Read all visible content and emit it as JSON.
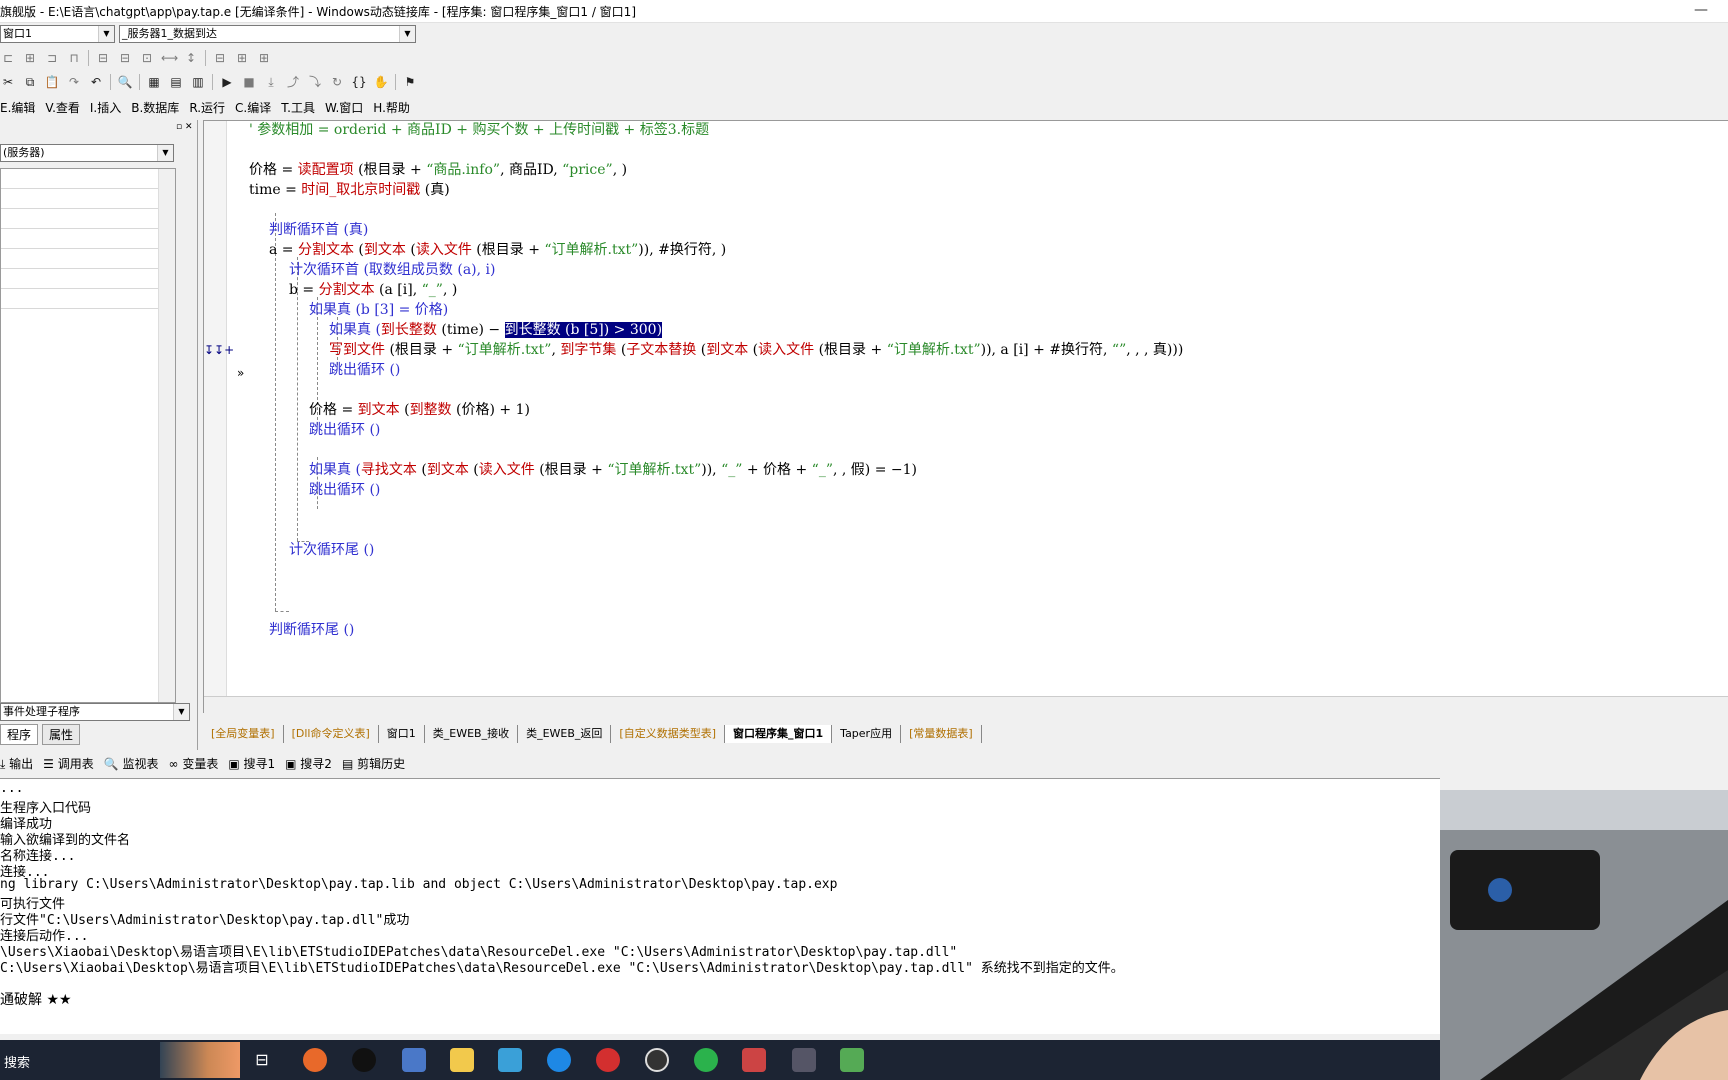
{
  "window": {
    "title": "旗舰版 - E:\\E语言\\chatgpt\\app\\pay.tap.e [无编译条件] - Windows动态链接库 - [程序集: 窗口程序集_窗口1 / 窗口1]",
    "minimize_glyph": "—"
  },
  "combos": {
    "left": "窗口1",
    "right": "_服务器1_数据到达"
  },
  "menu": [
    "E.编辑",
    "V.查看",
    "I.插入",
    "B.数据库",
    "R.运行",
    "C.编译",
    "T.工具",
    "W.窗口",
    "H.帮助"
  ],
  "left_panel": {
    "combo_top": "(服务器)",
    "combo_bottom": "事件处理子程序",
    "tab_program": "程序",
    "tab_properties": "属性"
  },
  "code": {
    "line1": "' 参数相加 = orderid + 商品ID + 购买个数 + 上传时间戳 + 标签3.标题",
    "line2a": "价格 = ",
    "line2b": "读配置项",
    "line2c": " (根目录 + ",
    "line2d": "“商品.info”",
    "line2e": ", 商品ID, ",
    "line2f": "“price”",
    "line2g": ", )",
    "line3a": "time = ",
    "line3b": "时间_取北京时间戳",
    "line3c": " (真)",
    "line4": "判断循环首 (真)",
    "line5a": "a = ",
    "line5b": "分割文本",
    "line5c": " (",
    "line5d": "到文本",
    "line5e": " (",
    "line5f": "读入文件",
    "line5g": " (根目录 + ",
    "line5h": "“订单解析.txt”",
    "line5i": ")), #换行符, )",
    "line6": "计次循环首 (取数组成员数 (a), i)",
    "line7a": "b = ",
    "line7b": "分割文本",
    "line7c": " (a [i], ",
    "line7d": "“_”",
    "line7e": ", )",
    "line8": "如果真 (b [3] = 价格)",
    "line9a": "如果真 (",
    "line9b": "到长整数",
    "line9c": " (time) − ",
    "line9d": "到长整数 (b [5]) > 300)",
    "line10a": "写到文件",
    "line10b": " (根目录 + ",
    "line10c": "“订单解析.txt”",
    "line10d": ", ",
    "line10e": "到字节集",
    "line10f": " (",
    "line10g": "子文本替换",
    "line10h": " (",
    "line10i": "到文本",
    "line10j": " (",
    "line10k": "读入文件",
    "line10l": " (根目录 + ",
    "line10m": "“订单解析.txt”",
    "line10n": ")), a [i] + #换行符, ",
    "line10o": "“”",
    "line10p": ", , , 真)))",
    "line11": "跳出循环 ()",
    "line12a": "价格 = ",
    "line12b": "到文本",
    "line12c": " (",
    "line12d": "到整数",
    "line12e": " (价格) + 1)",
    "line13": "跳出循环 ()",
    "line14a": "如果真 (",
    "line14b": "寻找文本",
    "line14c": " (",
    "line14d": "到文本",
    "line14e": " (",
    "line14f": "读入文件",
    "line14g": " (根目录 + ",
    "line14h": "“订单解析.txt”",
    "line14i": ")), ",
    "line14j": "“_”",
    "line14k": " + 价格 + ",
    "line14l": "“_”",
    "line14m": ", , 假) = −1)",
    "line15": "跳出循环 ()",
    "line16": "计次循环尾 ()",
    "line17": "判断循环尾 ()",
    "gutter_marks": "↧↧+",
    "gutter_mark2": "»"
  },
  "tabs": [
    "[全局变量表]",
    "[Dll命令定义表]",
    "窗口1",
    "类_EWEB_接收",
    "类_EWEB_返回",
    "[自定义数据类型表]",
    "窗口程序集_窗口1",
    "Taper应用",
    "[常量数据表]"
  ],
  "bottom_toolbar": [
    "输出",
    "调用表",
    "监视表",
    "变量表",
    "搜寻1",
    "搜寻2",
    "剪辑历史"
  ],
  "output_lines": [
    "...",
    "生程序入口代码",
    "编译成功",
    "输入欲编译到的文件名",
    "名称连接...",
    "连接...",
    "ng library C:\\Users\\Administrator\\Desktop\\pay.tap.lib and object C:\\Users\\Administrator\\Desktop\\pay.tap.exp",
    "可执行文件",
    "行文件\"C:\\Users\\Administrator\\Desktop\\pay.tap.dll\"成功",
    "连接后动作...",
    "\\Users\\Xiaobai\\Desktop\\易语言项目\\E\\lib\\ETStudioIDEPatches\\data\\ResourceDel.exe \"C:\\Users\\Administrator\\Desktop\\pay.tap.dll\"",
    "C:\\Users\\Xiaobai\\Desktop\\易语言项目\\E\\lib\\ETStudioIDEPatches\\data\\ResourceDel.exe \"C:\\Users\\Administrator\\Desktop\\pay.tap.dll\" 系统找不到指定的文件。",
    "",
    "通破解 ★★"
  ],
  "taskbar": {
    "search_text": "搜索"
  },
  "colors": {
    "keyword": "#3030d0",
    "function": "#c00000",
    "string": "#2a8a2a",
    "selection": "#000080",
    "taskbar": "#1c2433"
  }
}
